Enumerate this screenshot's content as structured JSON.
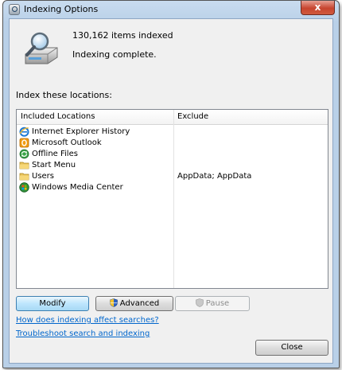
{
  "window": {
    "title": "Indexing Options",
    "close_glyph": "x"
  },
  "status": {
    "items_indexed": "130,162 items indexed",
    "state": "Indexing complete."
  },
  "locations": {
    "label": "Index these locations:",
    "headers": {
      "included": "Included Locations",
      "exclude": "Exclude"
    },
    "rows": [
      {
        "name": "Internet Explorer History",
        "exclude": "",
        "icon": "internet-explorer-icon"
      },
      {
        "name": "Microsoft Outlook",
        "exclude": "",
        "icon": "outlook-icon"
      },
      {
        "name": "Offline Files",
        "exclude": "",
        "icon": "offline-files-icon"
      },
      {
        "name": "Start Menu",
        "exclude": "",
        "icon": "folder-icon"
      },
      {
        "name": "Users",
        "exclude": "AppData; AppData",
        "icon": "folder-icon"
      },
      {
        "name": "Windows Media Center",
        "exclude": "",
        "icon": "windows-media-center-icon"
      }
    ]
  },
  "buttons": {
    "modify": "Modify",
    "advanced": "Advanced",
    "pause": "Pause",
    "close": "Close"
  },
  "links": {
    "how_affect": "How does indexing affect searches?",
    "troubleshoot": "Troubleshoot search and indexing"
  },
  "colors": {
    "link": "#0066cc",
    "title_bar": "#b9d0e8",
    "close_button": "#c7452f",
    "default_button_border": "#3c7fb1"
  }
}
